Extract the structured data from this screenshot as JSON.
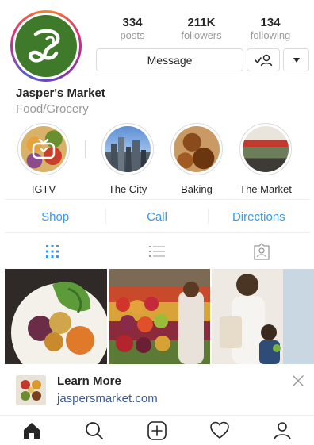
{
  "profile": {
    "name": "Jasper's Market",
    "category": "Food/Grocery"
  },
  "stats": [
    {
      "num": "334",
      "label": "posts"
    },
    {
      "num": "211K",
      "label": "followers"
    },
    {
      "num": "134",
      "label": "following"
    }
  ],
  "buttons": {
    "message": "Message"
  },
  "highlights": [
    {
      "label": "IGTV"
    },
    {
      "label": "The City"
    },
    {
      "label": "Baking"
    },
    {
      "label": "The Market"
    }
  ],
  "actions": {
    "shop": "Shop",
    "call": "Call",
    "directions": "Directions"
  },
  "promo": {
    "title": "Learn More",
    "url": "jaspersmarket.com"
  },
  "icons": {
    "grid_tab": "grid-icon",
    "list_tab": "list-icon",
    "tagged_tab": "tagged-icon",
    "home": "home-icon",
    "search": "search-icon",
    "add": "add-post-icon",
    "activity": "heart-icon",
    "profile": "profile-icon"
  },
  "colors": {
    "accent": "#3897f0",
    "link": "#3a5a98",
    "avatar_green": "#3f7a2b"
  }
}
